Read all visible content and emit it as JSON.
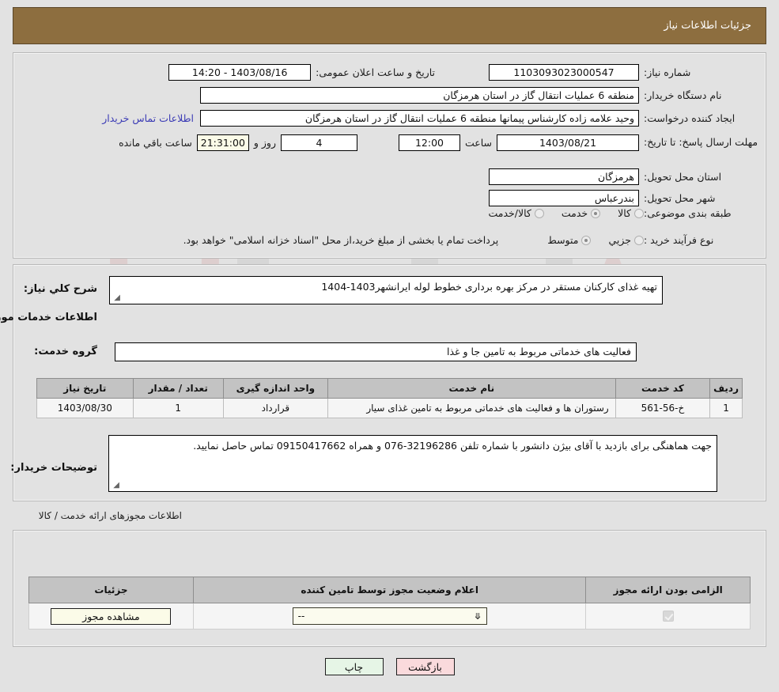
{
  "header": {
    "title": "جزئیات اطلاعات نیاز"
  },
  "form": {
    "need_number_label": "شماره نیاز:",
    "need_number_value": "1103093023000547",
    "announce_label": "تاریخ و ساعت اعلان عمومی:",
    "announce_value": "1403/08/16 - 14:20",
    "buyer_org_label": "نام دستگاه خریدار:",
    "buyer_org_value": "منطقه 6 عملیات انتقال گاز در استان هرمزگان",
    "requester_label": "ایجاد کننده درخواست:",
    "requester_value": "وحید علامه زاده کارشناس پیمانها منطقه 6 عملیات انتقال گاز در استان هرمزگان",
    "contact_link": "اطلاعات تماس خریدار",
    "deadline_label": "مهلت ارسال پاسخ: تا تاریخ:",
    "deadline_date": "1403/08/21",
    "hour_label": "ساعت",
    "deadline_time": "12:00",
    "days_value": "4",
    "days_label": "روز و",
    "remaining_time": "21:31:00",
    "remaining_label": "ساعت باقي مانده",
    "province_label": "استان محل تحویل:",
    "province_value": "هرمزگان",
    "city_label": "شهر محل تحویل:",
    "city_value": "بندرعباس",
    "category_label": "طبقه بندی موضوعی:",
    "category_options": [
      {
        "label": "کالا",
        "checked": false
      },
      {
        "label": "خدمت",
        "checked": true
      },
      {
        "label": "کالا/خدمت",
        "checked": false
      }
    ],
    "process_label": "نوع فرآیند خرید :",
    "process_options": [
      {
        "label": "جزیي",
        "checked": false
      },
      {
        "label": "متوسط",
        "checked": true
      }
    ],
    "process_note": "پرداخت تمام یا بخشی از مبلغ خرید،از محل \"اسناد خزانه اسلامی\" خواهد بود."
  },
  "description": {
    "label": "شرح کلي نیاز:",
    "value": "تهیه غذای کارکنان مستقر در مرکز بهره برداری خطوط لوله ایرانشهر1403-1404"
  },
  "services": {
    "section_title": "اطلاعات خدمات مورد نیاز",
    "group_label": "گروه خدمت:",
    "group_value": "فعالیت های خدماتی مربوط به تامین جا و غذا",
    "columns": [
      "ردیف",
      "کد خدمت",
      "نام خدمت",
      "واحد اندازه گیری",
      "تعداد / مقدار",
      "تاریخ نیاز"
    ],
    "rows": [
      {
        "radif": "1",
        "code": "خ-56-561",
        "name": "رستوران ها و فعالیت های خدماتی مربوط به تامین غذای سیار",
        "unit": "قرارداد",
        "qty": "1",
        "date": "1403/08/30"
      }
    ]
  },
  "buyer_notes": {
    "label": "توضیحات خریدار:",
    "value": "جهت هماهنگی برای بازدید با آقای بیژن دانشور با شماره تلفن 32196286-076 و همراه 09150417662 تماس حاصل نمایید."
  },
  "permits": {
    "section_title": "اطلاعات مجوزهای ارائه خدمت / کالا",
    "columns": [
      "الزامی بودن ارائه مجوز",
      "اعلام وضعیت مجوز توسط تامین کننده",
      "جزئیات"
    ],
    "rows": [
      {
        "required_checked": true,
        "status_value": "--",
        "detail_button": "مشاهده مجوز"
      }
    ]
  },
  "footer": {
    "print_label": "چاپ",
    "back_label": "بازگشت"
  },
  "colors": {
    "header_bar": "#8d6e3f",
    "page_bg": "#e2e2e2",
    "link": "#3b3bb5",
    "field_bg": "#ffffff",
    "cream_field": "#fbfbe8",
    "table_header": "#c3c3c3",
    "print_btn": "#e6f5e6",
    "back_btn": "#fadadc"
  },
  "watermark": {
    "text": "AriaTender.net"
  }
}
